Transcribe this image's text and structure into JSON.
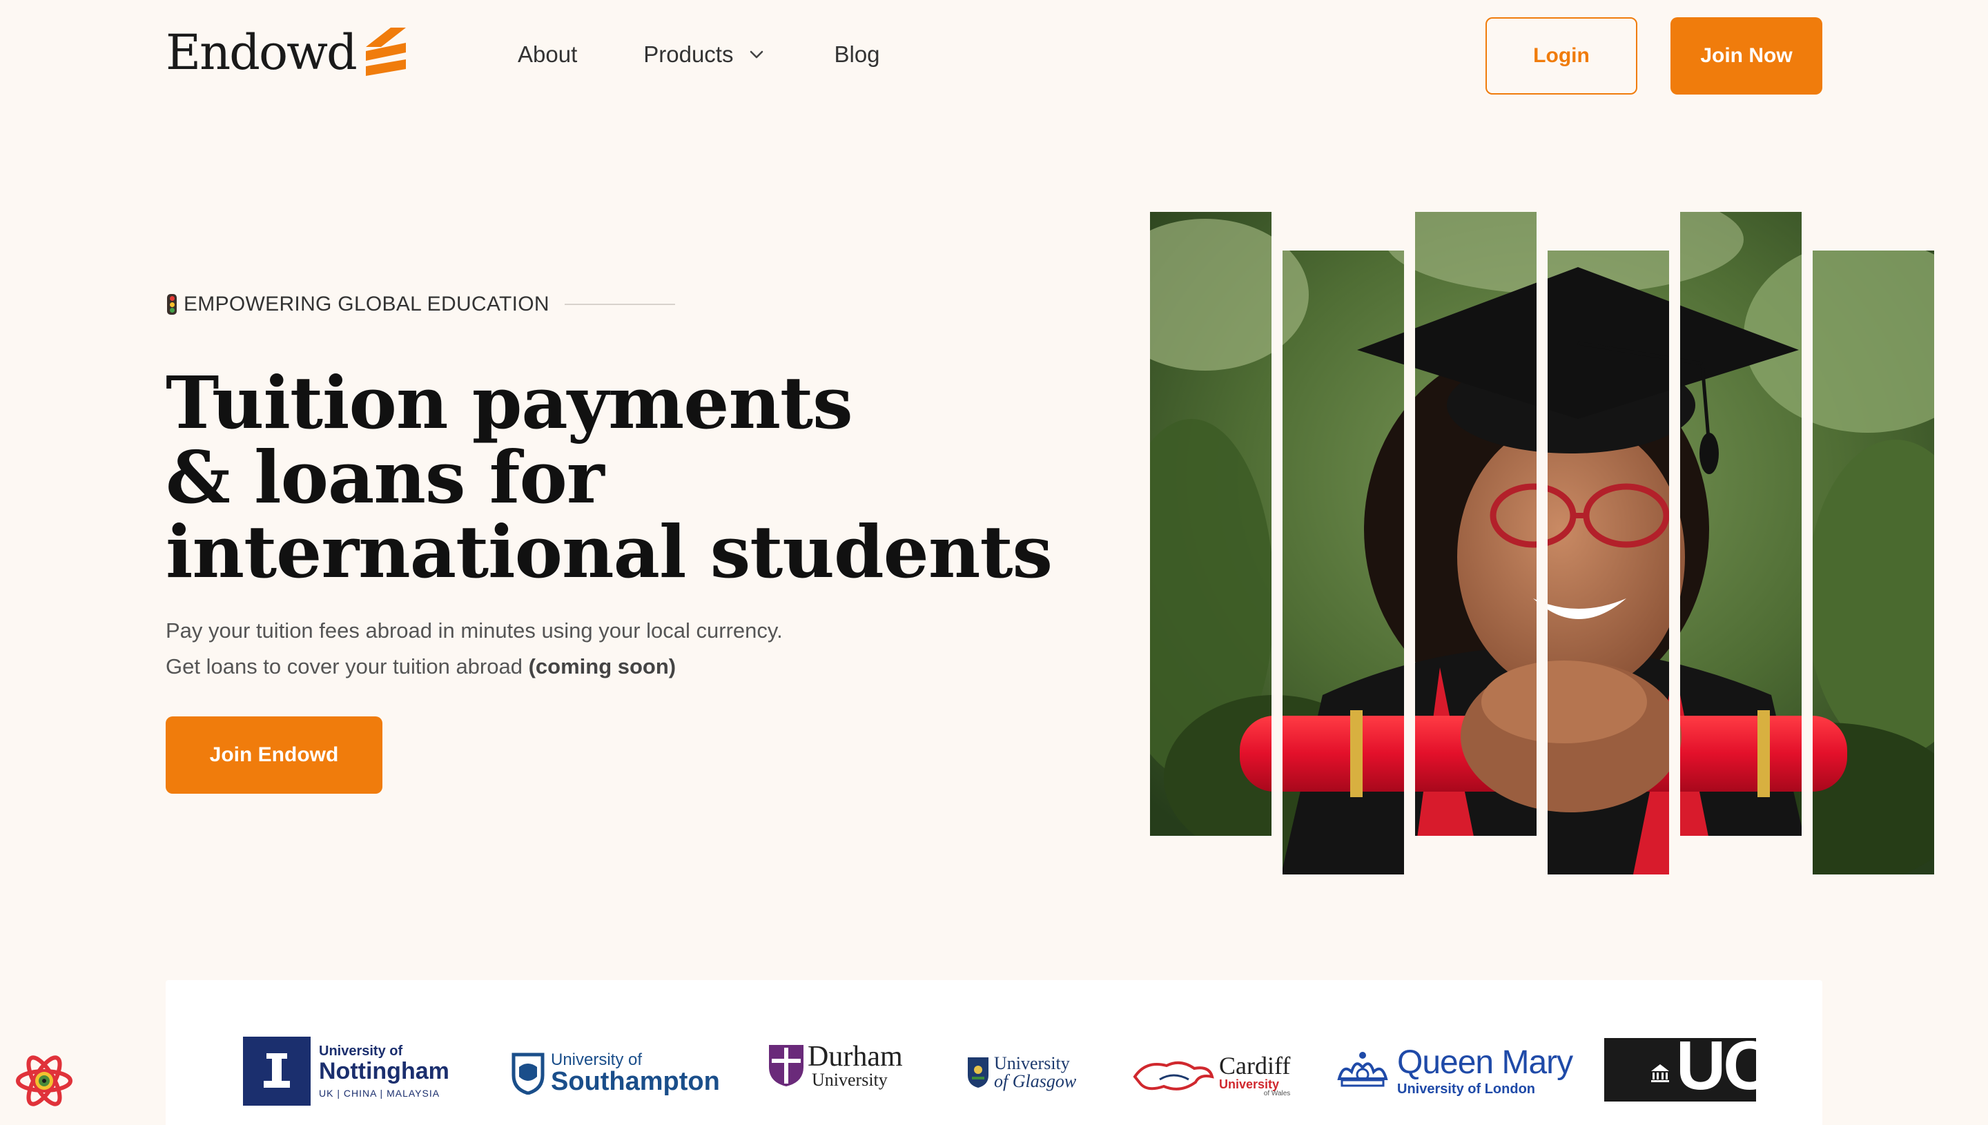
{
  "header": {
    "logo_text": "Endowd",
    "nav": [
      {
        "label": "About"
      },
      {
        "label": "Products",
        "has_dropdown": true,
        "icon": "chevron-down-icon"
      },
      {
        "label": "Blog"
      }
    ],
    "login_label": "Login",
    "join_label": "Join Now"
  },
  "hero": {
    "eyebrow": "EMPOWERING GLOBAL EDUCATION",
    "eyebrow_icon": "traffic-light-icon",
    "headline": [
      "Tuition payments",
      "& loans for",
      "international students"
    ],
    "sub_line1": "Pay your tuition fees abroad in minutes using your local currency.",
    "sub_line2_prefix": "Get loans to cover your tuition abroad ",
    "sub_line2_bold": "(coming soon)",
    "cta_label": "Join Endowd",
    "image_description_icon": "graduate-photo-strips"
  },
  "universities": {
    "nottingham": {
      "line1": "University of",
      "line2": "Nottingham",
      "line3": "UK | CHINA | MALAYSIA"
    },
    "southampton": {
      "line1": "University of",
      "line2": "Southampton"
    },
    "durham": {
      "line1": "Durham",
      "line2": "University"
    },
    "glasgow": {
      "line1": "University",
      "line2": "of Glasgow"
    },
    "cardiff": {
      "line1": "Cardiff",
      "line2": "University",
      "line3": "of Wales"
    },
    "queen_mary": {
      "line1": "Queen Mary",
      "line2": "University of London"
    },
    "ucl": {
      "line1": "UC"
    }
  },
  "colors": {
    "accent": "#f07c0c",
    "background": "#fdf8f3",
    "text": "#111111"
  }
}
